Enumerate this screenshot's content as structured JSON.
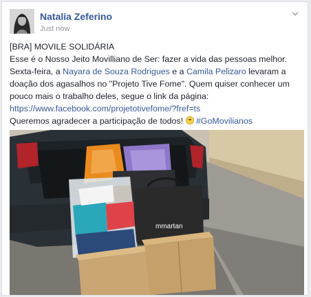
{
  "post": {
    "author": "Natalia Zeferino",
    "timestamp": "Just now",
    "lines": {
      "l1": "[BRA] MOVILE SOLIDÁRIA",
      "l2": "Esse é o Nosso Jeito Movilliano de Ser: fazer a vida das pessoas melhor.",
      "l3_a": "Sexta-feira, a ",
      "l3_link1": "Nayara de Souza Rodrigues",
      "l3_b": " e a ",
      "l3_link2": "Camila Pelizaro",
      "l3_c": " levaram a",
      "l4": "doação dos agasalhos no \"Projeto Tive Fome\". Quem quiser conhecer um",
      "l5": "pouco mais o trabalho deles, segue o link da página:",
      "l6_link": "https://www.facebook.com/projetotivefome/?fref=ts",
      "l7_a": "Queremos agradecer a participação de todos! ",
      "l7_hashtag": "#GoMovilianos"
    },
    "photo": {
      "bag_brand": "mmartan"
    }
  },
  "colors": {
    "link": "#365899",
    "text": "#1d2129",
    "meta": "#90949c",
    "background": "#e9ebee"
  },
  "icons": {
    "chevron": "chevron-down-icon",
    "emoji": "smiley-emoji-icon"
  }
}
